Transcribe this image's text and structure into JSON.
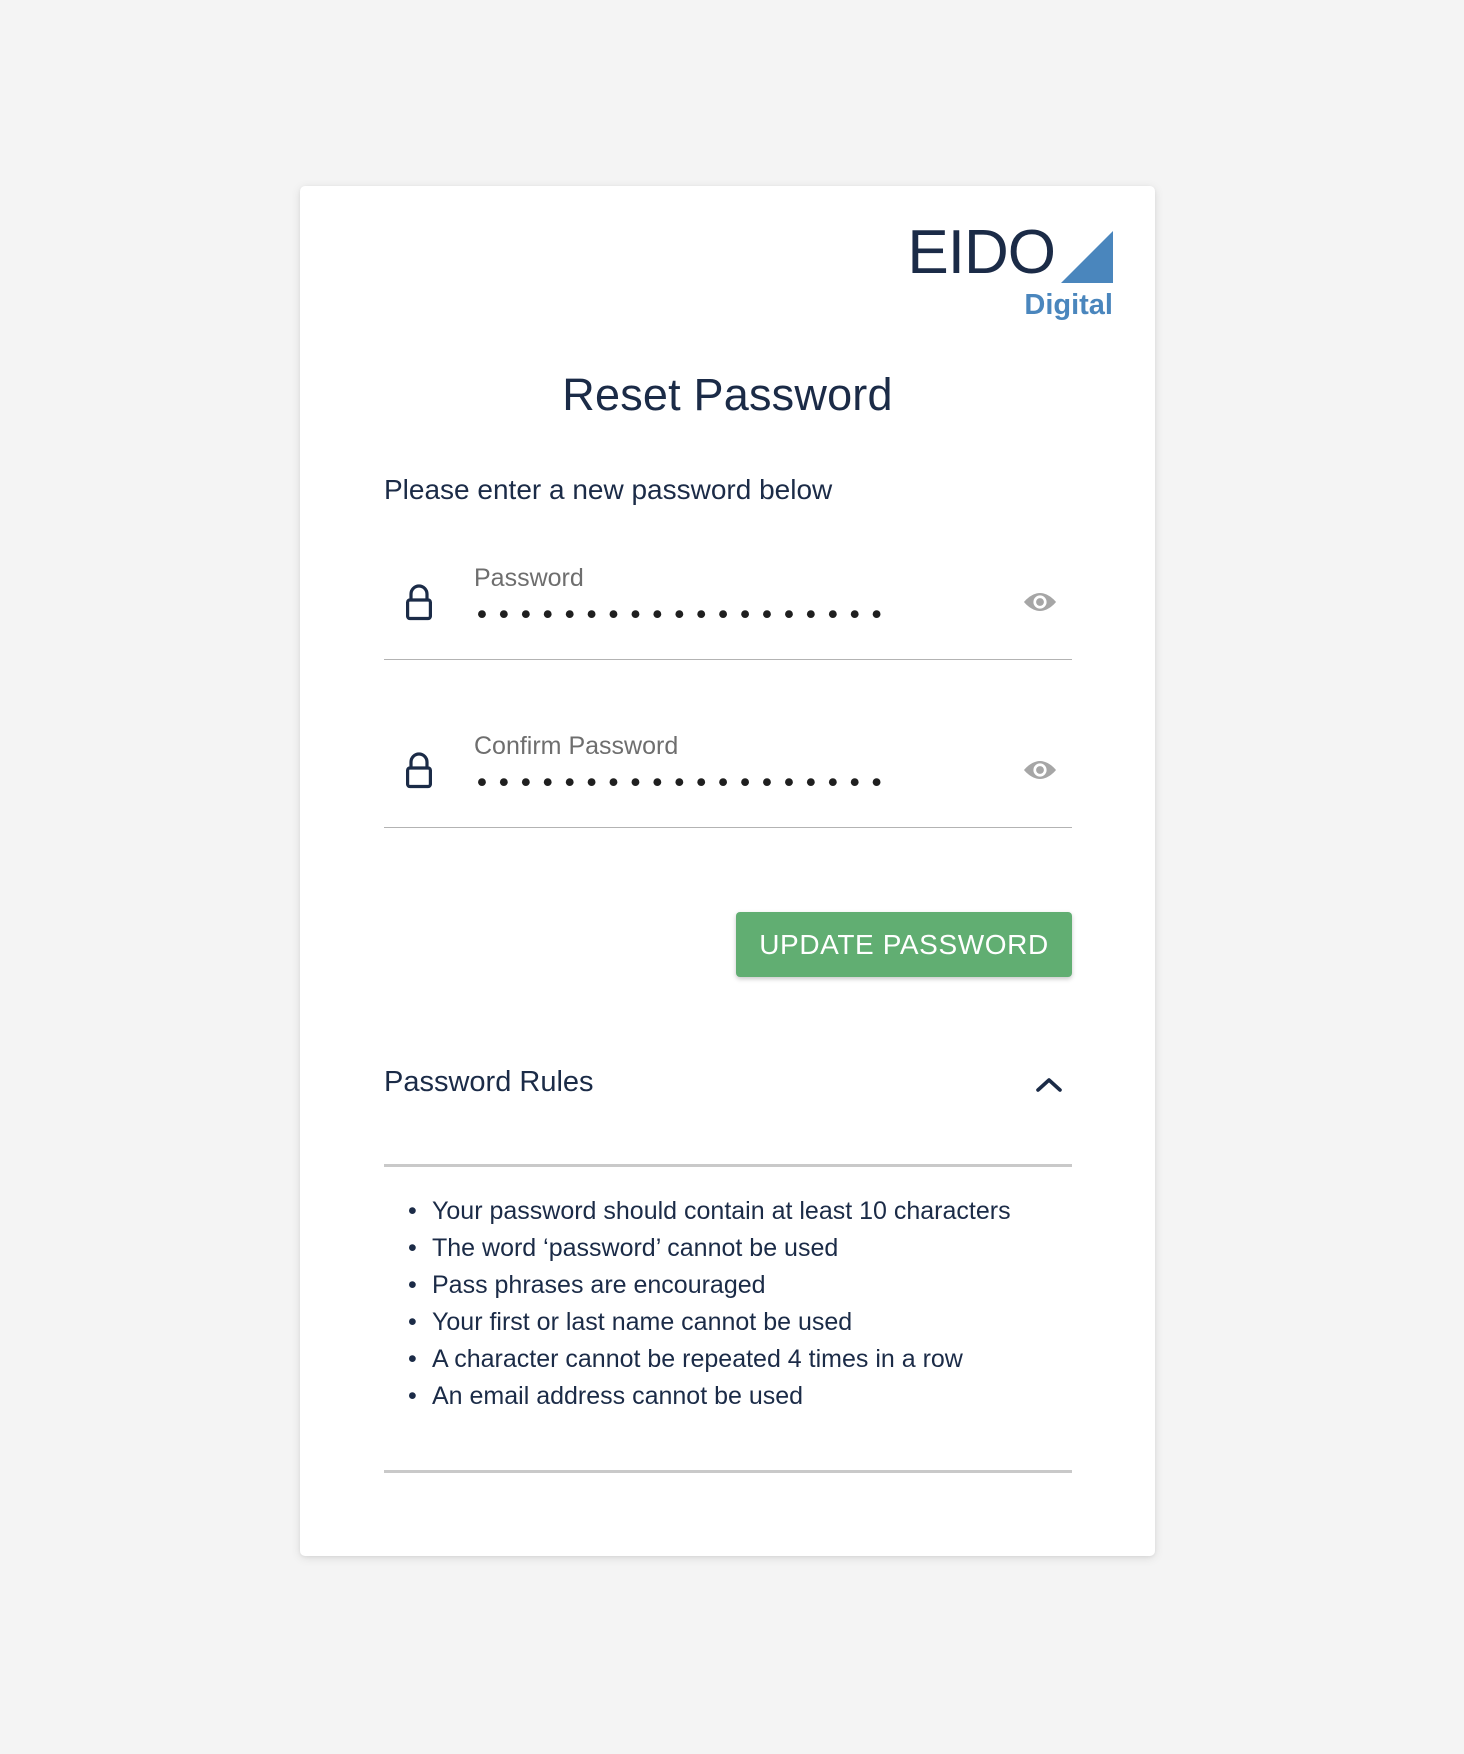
{
  "brand": {
    "logo_word": "EIDO",
    "logo_sub": "Digital",
    "logo_color": "#1b2b47",
    "accent_color": "#4a86bd",
    "triangle_icon": "triangle-icon"
  },
  "page": {
    "title": "Reset Password",
    "subtitle": "Please enter a new password below",
    "background_color": "#f4f4f4",
    "card_color": "#ffffff",
    "text_color": "#1b2b47"
  },
  "form": {
    "password": {
      "label": "Password",
      "value": "•••••••••••••••••••",
      "placeholder": "Password",
      "lock_icon": "lock-icon",
      "toggle_icon": "eye-icon"
    },
    "confirm_password": {
      "label": "Confirm Password",
      "value": "•••••••••••••••••••",
      "placeholder": "Confirm Password",
      "lock_icon": "lock-icon",
      "toggle_icon": "eye-icon"
    },
    "submit_label": "UPDATE PASSWORD",
    "submit_color": "#61ae72"
  },
  "rules_section": {
    "title": "Password Rules",
    "toggle_icon": "chevron-up-icon",
    "expanded": true,
    "items": [
      "Your password should contain at least 10 characters",
      "The word ‘password’ cannot be used",
      "Pass phrases are encouraged",
      "Your first or last name cannot be used",
      "A character cannot be repeated 4 times in a row",
      "An email address cannot be used"
    ]
  }
}
